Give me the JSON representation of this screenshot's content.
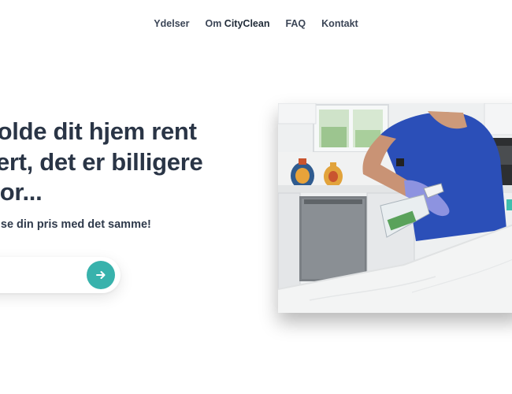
{
  "nav": {
    "items": [
      {
        "label": "Ydelser"
      },
      {
        "prefix": "Om",
        "brand": "CityClean"
      },
      {
        "label": "FAQ"
      },
      {
        "label": "Kontakt"
      }
    ]
  },
  "hero": {
    "title_lines": [
      "holde dit hjem rent",
      "kert, det er billigere",
      "tror..."
    ],
    "subtitle": "g se din pris med det samme!",
    "input": {
      "value": "."
    },
    "submit_icon": "arrow-right-icon"
  },
  "image": {
    "subject": "cleaning-photo"
  },
  "colors": {
    "accent": "#38b2ac",
    "heading": "#2a3546",
    "nav_text": "#3b4556"
  }
}
